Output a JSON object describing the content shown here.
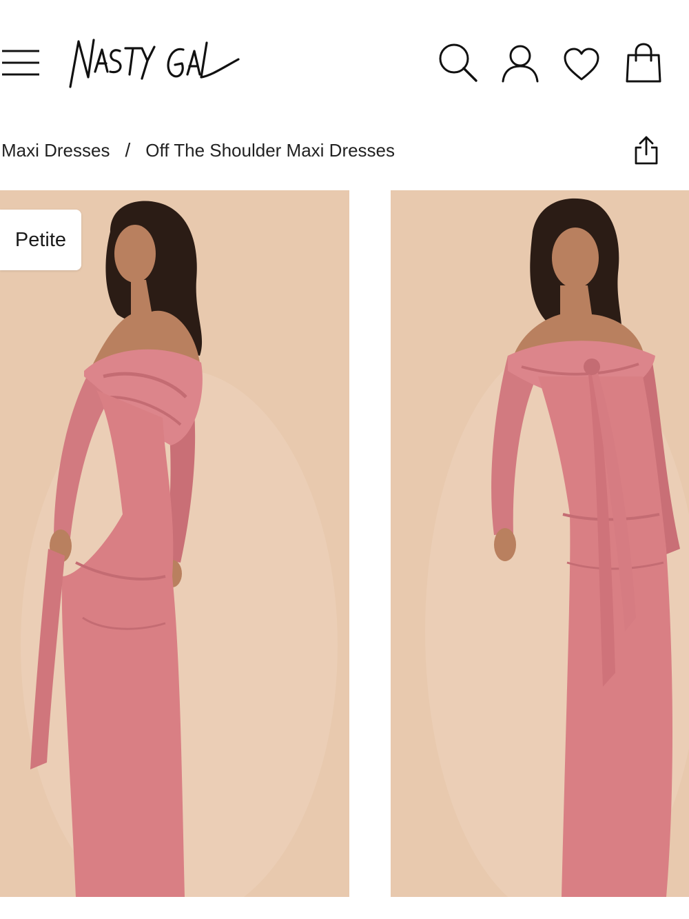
{
  "header": {
    "logo_text": "NASTY GAL",
    "icons": [
      "menu-icon",
      "search-icon",
      "account-icon",
      "heart-icon",
      "bag-icon"
    ]
  },
  "breadcrumb": {
    "items": [
      "Maxi Dresses",
      "Off The Shoulder Maxi Dresses"
    ],
    "separator": "/",
    "share_icon": "share-icon"
  },
  "gallery": {
    "tag_label": "Petite",
    "background_color": "#e8c9ae",
    "dress_color": "#d97f84",
    "images": [
      "back-view",
      "front-view"
    ]
  }
}
